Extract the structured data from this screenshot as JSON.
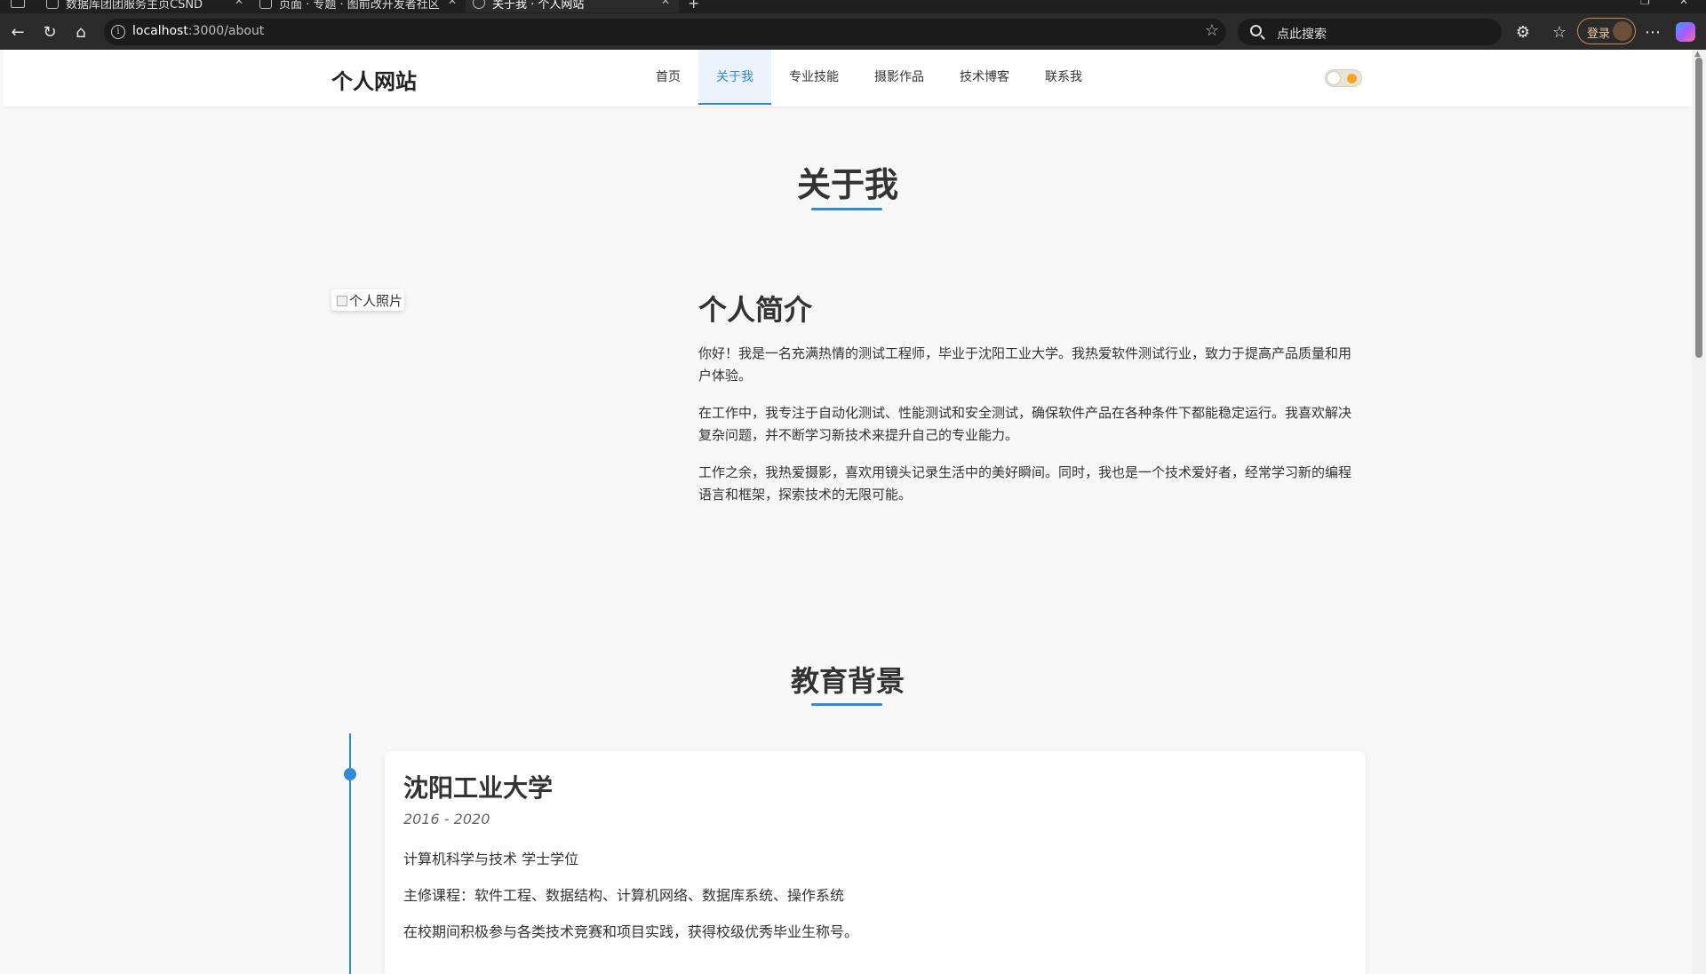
{
  "browser": {
    "tabs": [
      {
        "label": "数据库团团服务主页CSND"
      },
      {
        "label": "页面 · 专题 · 图前改开发者社区"
      },
      {
        "label": "关于我 · 个人网站",
        "active": true
      }
    ],
    "address": {
      "host": "localhost",
      "path": ":3000/about"
    },
    "search_placeholder": "点此搜索",
    "login_label": "登录"
  },
  "site": {
    "brand": "个人网站",
    "nav": [
      {
        "label": "首页"
      },
      {
        "label": "关于我",
        "active": true
      },
      {
        "label": "专业技能"
      },
      {
        "label": "摄影作品"
      },
      {
        "label": "技术博客"
      },
      {
        "label": "联系我"
      }
    ],
    "theme_toggle": {
      "state": "light"
    }
  },
  "about": {
    "title": "关于我",
    "photo_alt": "个人照片",
    "intro": {
      "heading": "个人简介",
      "paragraphs": [
        "你好！我是一名充满热情的测试工程师，毕业于沈阳工业大学。我热爱软件测试行业，致力于提高产品质量和用户体验。",
        "在工作中，我专注于自动化测试、性能测试和安全测试，确保软件产品在各种条件下都能稳定运行。我喜欢解决复杂问题，并不断学习新技术来提升自己的专业能力。",
        "工作之余，我热爱摄影，喜欢用镜头记录生活中的美好瞬间。同时，我也是一个技术爱好者，经常学习新的编程语言和框架，探索技术的无限可能。"
      ]
    }
  },
  "education": {
    "title": "教育背景",
    "items": [
      {
        "school": "沈阳工业大学",
        "years": "2016 - 2020",
        "degree": "计算机科学与技术 学士学位",
        "courses": "主修课程：软件工程、数据结构、计算机网络、数据库系统、操作系统",
        "note": "在校期间积极参与各类技术竞赛和项目实践，获得校级优秀毕业生称号。"
      }
    ]
  },
  "colors": {
    "accent": "#2f8bd8",
    "page_bg": "#f8f8f8",
    "chrome_bg": "#2b2b2b"
  }
}
